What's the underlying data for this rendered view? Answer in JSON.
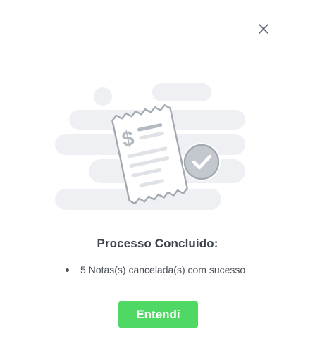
{
  "modal": {
    "title": "Processo Concluído:",
    "results": [
      {
        "text": "5 Notas(s) cancelada(s) com sucesso"
      }
    ],
    "confirm_label": "Entendi",
    "close_icon": "close-icon",
    "illustration_icon": "receipt-check-icon"
  },
  "colors": {
    "accent": "#4fd964",
    "title": "#3d4450",
    "text": "#4a4f57",
    "cloud": "#eef0f3",
    "receipt_stroke": "#a3a9b1",
    "check_circle": "#c3c8cf"
  }
}
